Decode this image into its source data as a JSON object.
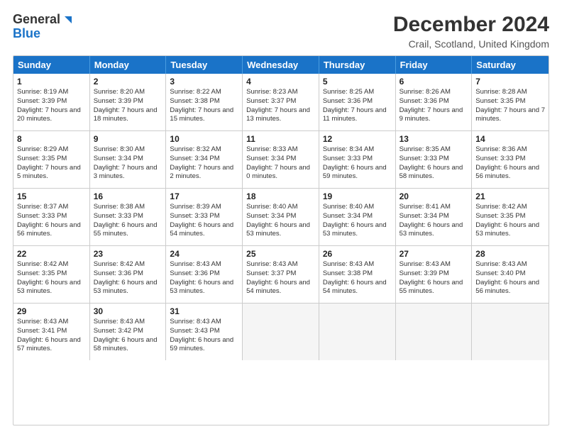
{
  "header": {
    "logo_line1": "General",
    "logo_line2": "Blue",
    "month_title": "December 2024",
    "location": "Crail, Scotland, United Kingdom"
  },
  "days_of_week": [
    "Sunday",
    "Monday",
    "Tuesday",
    "Wednesday",
    "Thursday",
    "Friday",
    "Saturday"
  ],
  "weeks": [
    [
      {
        "day": 1,
        "sunrise": "8:19 AM",
        "sunset": "3:39 PM",
        "daylight": "7 hours and 20 minutes."
      },
      {
        "day": 2,
        "sunrise": "8:20 AM",
        "sunset": "3:39 PM",
        "daylight": "7 hours and 18 minutes."
      },
      {
        "day": 3,
        "sunrise": "8:22 AM",
        "sunset": "3:38 PM",
        "daylight": "7 hours and 15 minutes."
      },
      {
        "day": 4,
        "sunrise": "8:23 AM",
        "sunset": "3:37 PM",
        "daylight": "7 hours and 13 minutes."
      },
      {
        "day": 5,
        "sunrise": "8:25 AM",
        "sunset": "3:36 PM",
        "daylight": "7 hours and 11 minutes."
      },
      {
        "day": 6,
        "sunrise": "8:26 AM",
        "sunset": "3:36 PM",
        "daylight": "7 hours and 9 minutes."
      },
      {
        "day": 7,
        "sunrise": "8:28 AM",
        "sunset": "3:35 PM",
        "daylight": "7 hours and 7 minutes."
      }
    ],
    [
      {
        "day": 8,
        "sunrise": "8:29 AM",
        "sunset": "3:35 PM",
        "daylight": "7 hours and 5 minutes."
      },
      {
        "day": 9,
        "sunrise": "8:30 AM",
        "sunset": "3:34 PM",
        "daylight": "7 hours and 3 minutes."
      },
      {
        "day": 10,
        "sunrise": "8:32 AM",
        "sunset": "3:34 PM",
        "daylight": "7 hours and 2 minutes."
      },
      {
        "day": 11,
        "sunrise": "8:33 AM",
        "sunset": "3:34 PM",
        "daylight": "7 hours and 0 minutes."
      },
      {
        "day": 12,
        "sunrise": "8:34 AM",
        "sunset": "3:33 PM",
        "daylight": "6 hours and 59 minutes."
      },
      {
        "day": 13,
        "sunrise": "8:35 AM",
        "sunset": "3:33 PM",
        "daylight": "6 hours and 58 minutes."
      },
      {
        "day": 14,
        "sunrise": "8:36 AM",
        "sunset": "3:33 PM",
        "daylight": "6 hours and 56 minutes."
      }
    ],
    [
      {
        "day": 15,
        "sunrise": "8:37 AM",
        "sunset": "3:33 PM",
        "daylight": "6 hours and 56 minutes."
      },
      {
        "day": 16,
        "sunrise": "8:38 AM",
        "sunset": "3:33 PM",
        "daylight": "6 hours and 55 minutes."
      },
      {
        "day": 17,
        "sunrise": "8:39 AM",
        "sunset": "3:33 PM",
        "daylight": "6 hours and 54 minutes."
      },
      {
        "day": 18,
        "sunrise": "8:40 AM",
        "sunset": "3:34 PM",
        "daylight": "6 hours and 53 minutes."
      },
      {
        "day": 19,
        "sunrise": "8:40 AM",
        "sunset": "3:34 PM",
        "daylight": "6 hours and 53 minutes."
      },
      {
        "day": 20,
        "sunrise": "8:41 AM",
        "sunset": "3:34 PM",
        "daylight": "6 hours and 53 minutes."
      },
      {
        "day": 21,
        "sunrise": "8:42 AM",
        "sunset": "3:35 PM",
        "daylight": "6 hours and 53 minutes."
      }
    ],
    [
      {
        "day": 22,
        "sunrise": "8:42 AM",
        "sunset": "3:35 PM",
        "daylight": "6 hours and 53 minutes."
      },
      {
        "day": 23,
        "sunrise": "8:42 AM",
        "sunset": "3:36 PM",
        "daylight": "6 hours and 53 minutes."
      },
      {
        "day": 24,
        "sunrise": "8:43 AM",
        "sunset": "3:36 PM",
        "daylight": "6 hours and 53 minutes."
      },
      {
        "day": 25,
        "sunrise": "8:43 AM",
        "sunset": "3:37 PM",
        "daylight": "6 hours and 54 minutes."
      },
      {
        "day": 26,
        "sunrise": "8:43 AM",
        "sunset": "3:38 PM",
        "daylight": "6 hours and 54 minutes."
      },
      {
        "day": 27,
        "sunrise": "8:43 AM",
        "sunset": "3:39 PM",
        "daylight": "6 hours and 55 minutes."
      },
      {
        "day": 28,
        "sunrise": "8:43 AM",
        "sunset": "3:40 PM",
        "daylight": "6 hours and 56 minutes."
      }
    ],
    [
      {
        "day": 29,
        "sunrise": "8:43 AM",
        "sunset": "3:41 PM",
        "daylight": "6 hours and 57 minutes."
      },
      {
        "day": 30,
        "sunrise": "8:43 AM",
        "sunset": "3:42 PM",
        "daylight": "6 hours and 58 minutes."
      },
      {
        "day": 31,
        "sunrise": "8:43 AM",
        "sunset": "3:43 PM",
        "daylight": "6 hours and 59 minutes."
      },
      null,
      null,
      null,
      null
    ]
  ]
}
